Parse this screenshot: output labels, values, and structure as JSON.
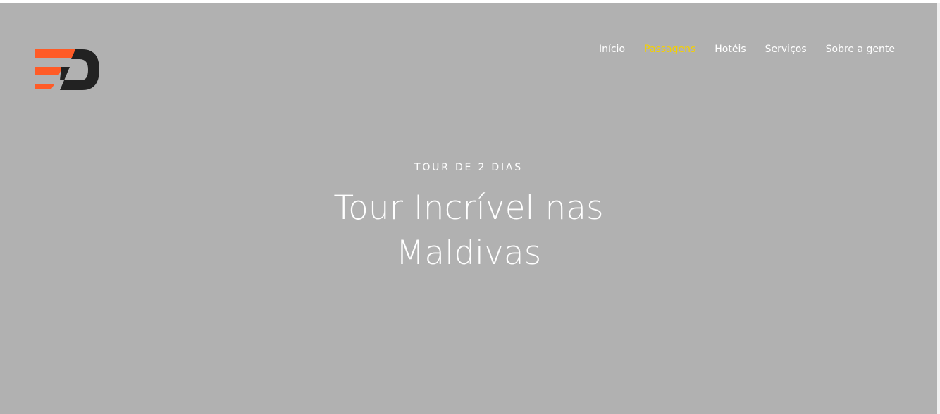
{
  "brand": {
    "logo_icon": "ed-logo-icon",
    "accent_color": "#ff5b26",
    "dark_color": "#222222"
  },
  "nav": {
    "items": [
      {
        "label": "Início",
        "active": false
      },
      {
        "label": "Passagens",
        "active": true
      },
      {
        "label": "Hotéis",
        "active": false
      },
      {
        "label": "Serviços",
        "active": false
      },
      {
        "label": "Sobre a gente",
        "active": false
      }
    ],
    "active_color": "#f5d000",
    "text_color": "#ffffff"
  },
  "hero": {
    "background_color": "#b1b1b1",
    "subtitle": "TOUR DE 2 DIAS",
    "title_line1": "Tour Incrível nas",
    "title_line2": "Maldivas"
  }
}
